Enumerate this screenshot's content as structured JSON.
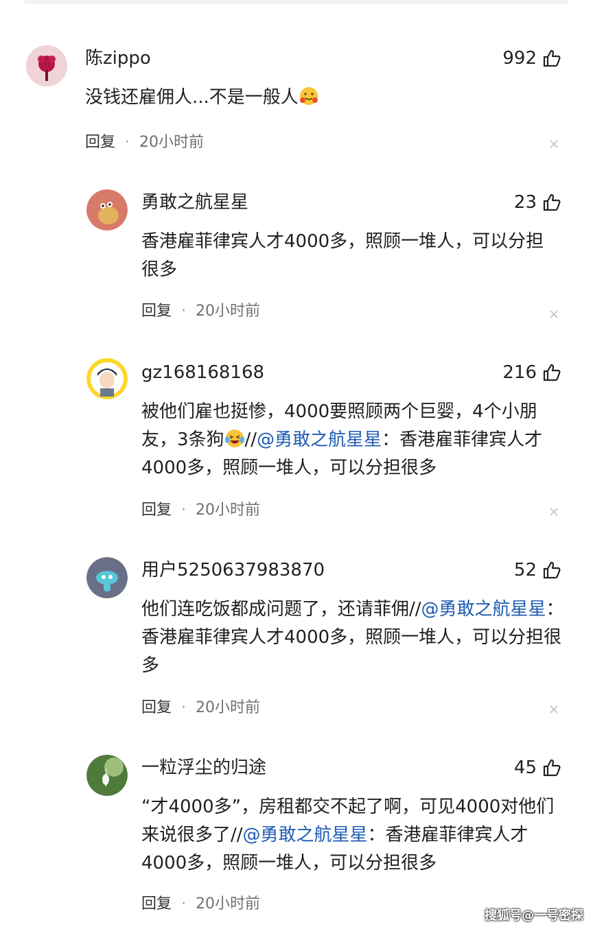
{
  "comments": [
    {
      "user": "陈zippo",
      "likes": "992",
      "text": "没钱还雇佣人...不是一般人",
      "reply": "回复",
      "sep": "·",
      "time": "20小时前"
    },
    {
      "user": "勇敢之航星星",
      "likes": "23",
      "text": "香港雇菲律宾人才4000多，照顾一堆人，可以分担很多",
      "reply": "回复",
      "sep": "·",
      "time": "20小时前"
    },
    {
      "user": "gz168168168",
      "likes": "216",
      "text_a": "被他们雇也挺惨，4000要照顾两个巨婴，4个小朋友，3条狗",
      "slashes": "//",
      "mention": "@勇敢之航星星",
      "text_b": "：香港雇菲律宾人才4000多，照顾一堆人，可以分担很多",
      "reply": "回复",
      "sep": "·",
      "time": "20小时前"
    },
    {
      "user": "用户5250637983870",
      "likes": "52",
      "text_a": "他们连吃饭都成问题了，还请菲佣//",
      "mention": "@勇敢之航星星",
      "text_b": "：香港雇菲律宾人才4000多，照顾一堆人，可以分担很多",
      "reply": "回复",
      "sep": "·",
      "time": "20小时前"
    },
    {
      "user": "一粒浮尘的归途",
      "likes": "45",
      "text_a": "“才4000多”，房租都交不起了啊，可见4000对他们来说很多了//",
      "mention": "@勇敢之航星星",
      "text_b": "：香港雇菲律宾人才4000多，照顾一堆人，可以分担很多",
      "reply": "回复",
      "sep": "·",
      "time": "20小时前"
    }
  ],
  "watermark": "搜狐号@一号密探",
  "colors": {
    "mention": "#1f5bb4",
    "meta": "#6f6f6f"
  }
}
